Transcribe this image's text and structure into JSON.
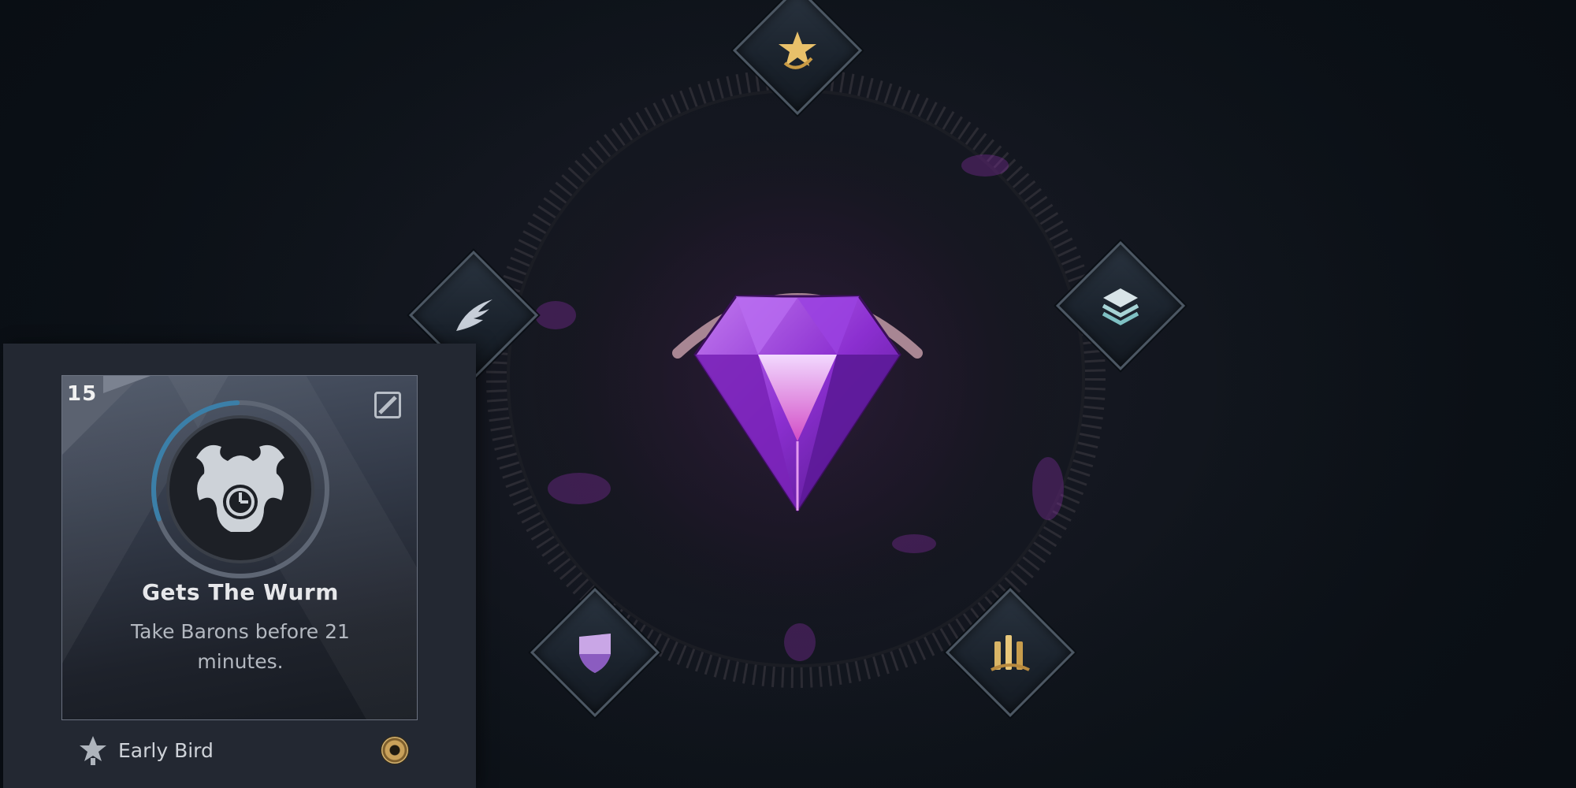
{
  "achievement_card": {
    "level": "15",
    "title": "Gets The Wurm",
    "description": "Take Barons before 21 minutes.",
    "title_footer": "Early Bird",
    "progress": 0.3
  },
  "nodes": [
    {
      "id": "top",
      "icon": "star-swirl-icon"
    },
    {
      "id": "left",
      "icon": "wing-icon"
    },
    {
      "id": "right",
      "icon": "layers-icon"
    },
    {
      "id": "bottom-left",
      "icon": "shield-icon"
    },
    {
      "id": "bottom-right",
      "icon": "pillars-icon"
    }
  ],
  "center_emblem": {
    "icon": "purple-gem-icon"
  },
  "colors": {
    "gem_purple": "#a43be0",
    "gem_rim": "#b8909c",
    "gold": "#c9a15a",
    "teal": "#8fd3d6",
    "card_bg": "#232832",
    "ring_blue": "#3b7fa8"
  }
}
